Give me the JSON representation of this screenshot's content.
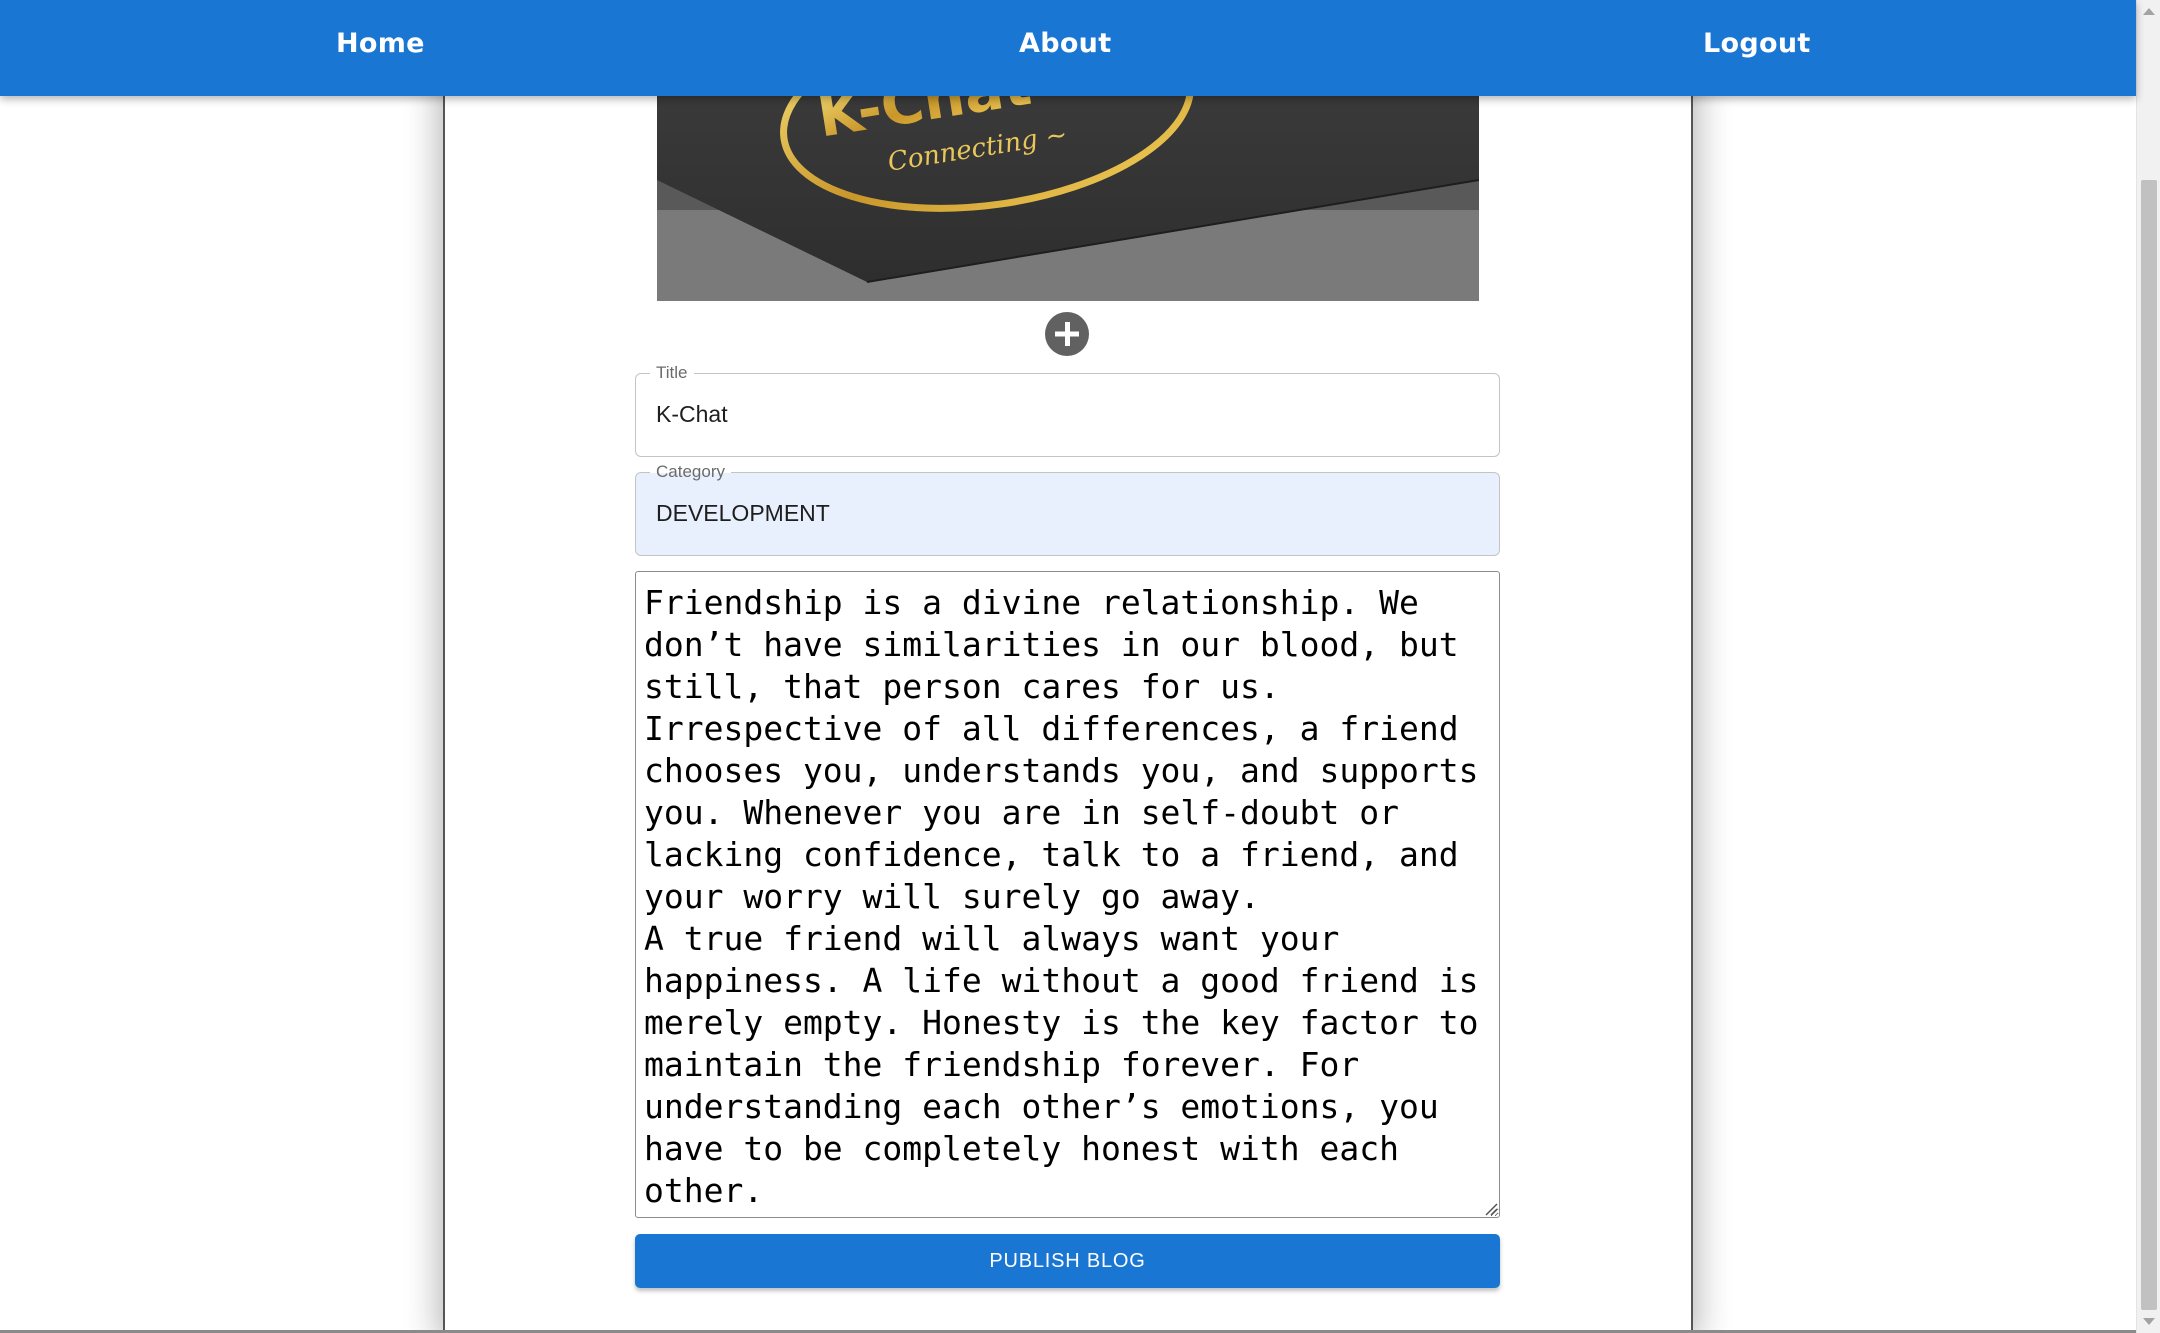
{
  "nav": {
    "home": "Home",
    "about": "About",
    "logout": "Logout"
  },
  "cover": {
    "logo_text": "K-Chat",
    "logo_tagline": "Connecting ~"
  },
  "form": {
    "title_label": "Title",
    "title_value": "K-Chat",
    "category_label": "Category",
    "category_value": "DEVELOPMENT",
    "content": "Friendship is a divine relationship. We don’t have similarities in our blood, but still, that person cares for us. Irrespective of all differences, a friend chooses you, understands you, and supports you. Whenever you are in self-doubt or lacking confidence, talk to a friend, and your worry will surely go away.\nA true friend will always want your happiness. A life without a good friend is merely empty. Honesty is the key factor to maintain the friendship forever. For understanding each other’s emotions, you have to be completely honest with each other.",
    "publish_label": "PUBLISH BLOG"
  },
  "colors": {
    "primary": "#1976d2",
    "add_icon_bg": "#616161",
    "category_fill": "#e8f0fe"
  },
  "icons": {
    "add": "plus-circle-icon",
    "resize": "resize-grip-icon"
  }
}
